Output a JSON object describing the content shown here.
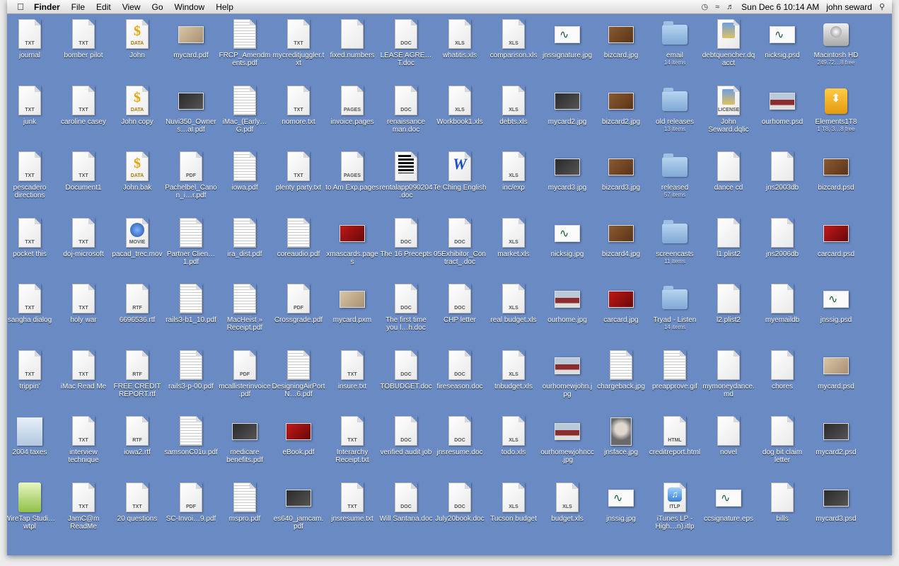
{
  "menubar": {
    "apple": "",
    "app": "Finder",
    "menus": [
      "File",
      "Edit",
      "View",
      "Go",
      "Window",
      "Help"
    ],
    "clock": "Sun Dec 6  10:14 AM",
    "user": "john seward",
    "status_icons": [
      "wifi-icon",
      "volume-icon",
      "time-machine-icon",
      "search-icon"
    ]
  },
  "desktop": {
    "columns": [
      [
        {
          "label": "journal",
          "kind": "txt",
          "tag": "TXT"
        },
        {
          "label": "junk",
          "kind": "txt",
          "tag": "TXT"
        },
        {
          "label": "pescadero directions",
          "kind": "txt",
          "tag": "TXT"
        },
        {
          "label": "pocket this",
          "kind": "txt",
          "tag": "TXT"
        },
        {
          "label": "sangha dialog",
          "kind": "txt",
          "tag": "TXT"
        },
        {
          "label": "trippin'",
          "kind": "txt",
          "tag": "TXT"
        },
        {
          "label": "2004 taxes",
          "kind": "taxes"
        },
        {
          "label": "WireTap Studi…wtpl",
          "kind": "wiretap"
        }
      ],
      [
        {
          "label": "bomber pilot",
          "kind": "txt",
          "tag": "TXT"
        },
        {
          "label": "caroline casey",
          "kind": "txt",
          "tag": "TXT"
        },
        {
          "label": "Document1",
          "kind": "txt",
          "tag": "TXT"
        },
        {
          "label": "doj-microsoft",
          "kind": "txt",
          "tag": "TXT"
        },
        {
          "label": "holy war",
          "kind": "txt",
          "tag": "TXT"
        },
        {
          "label": "iMac Read Me",
          "kind": "txt",
          "tag": "TXT"
        },
        {
          "label": "interview technique",
          "kind": "txt",
          "tag": "TXT"
        },
        {
          "label": "JamC@m ReadMe",
          "kind": "txt",
          "tag": "TXT"
        }
      ],
      [
        {
          "label": "John",
          "kind": "data",
          "tag": "DATA"
        },
        {
          "label": "John copy",
          "kind": "data",
          "tag": "DATA"
        },
        {
          "label": "John.bak",
          "kind": "data",
          "tag": "DATA"
        },
        {
          "label": "pacad_trec.mov",
          "kind": "movie",
          "tag": "MOVIE"
        },
        {
          "label": "6696536.rtf",
          "kind": "txt",
          "tag": "RTF"
        },
        {
          "label": "FREE CREDIT REPORT.rtf",
          "kind": "txt",
          "tag": "RTF"
        },
        {
          "label": "iowa2.rtf",
          "kind": "txt",
          "tag": "RTF"
        },
        {
          "label": "20 questions",
          "kind": "txt",
          "tag": "TXT"
        }
      ],
      [
        {
          "label": "mycard.pdf",
          "kind": "photo-tan"
        },
        {
          "label": "Nuvi350_Owners…al.pdf",
          "kind": "photo-dark"
        },
        {
          "label": "Pachelbel_Canon_i…r.pdf",
          "kind": "txt",
          "tag": "PDF"
        },
        {
          "label": "Partner Clien…1.pdf",
          "kind": "lines"
        },
        {
          "label": "rails3-b1_10.pdf",
          "kind": "lines"
        },
        {
          "label": "rails3-p-00.pdf",
          "kind": "lines"
        },
        {
          "label": "samsonC01u.pdf",
          "kind": "lines"
        },
        {
          "label": "SC-Invoi…9.pdf",
          "kind": "txt",
          "tag": "PDF"
        }
      ],
      [
        {
          "label": "FRCP_Amendments.pdf",
          "kind": "lines"
        },
        {
          "label": "iMac_(Early…G.pdf",
          "kind": "lines"
        },
        {
          "label": "iowa.pdf",
          "kind": "lines"
        },
        {
          "label": "ira_dist.pdf",
          "kind": "lines"
        },
        {
          "label": "MacHeist » Receipt.pdf",
          "kind": "lines"
        },
        {
          "label": "mcallisterinvoice.pdf",
          "kind": "txt",
          "tag": "PDF"
        },
        {
          "label": "medicare benefits.pdf",
          "kind": "photo-dark"
        },
        {
          "label": "mspro.pdf",
          "kind": "lines"
        }
      ],
      [
        {
          "label": "mycreditjuggler.txt",
          "kind": "txt",
          "tag": "TXT"
        },
        {
          "label": "nomore.txt",
          "kind": "txt",
          "tag": "TXT"
        },
        {
          "label": "plenty party.txt",
          "kind": "txt",
          "tag": "TXT"
        },
        {
          "label": "coreaudio.pdf",
          "kind": "lines"
        },
        {
          "label": "Crossgrade.pdf",
          "kind": "txt",
          "tag": "PDF"
        },
        {
          "label": "DesigningAirPortN…6.pdf",
          "kind": "lines"
        },
        {
          "label": "eBook.pdf",
          "kind": "photo-red"
        },
        {
          "label": "es640_jamcam.pdf",
          "kind": "photo-dark"
        }
      ],
      [
        {
          "label": "fixed.numbers",
          "kind": "txt",
          "tag": ""
        },
        {
          "label": "invoice.pages",
          "kind": "txt",
          "tag": "PAGES"
        },
        {
          "label": "to Am Exp.pages",
          "kind": "txt",
          "tag": "PAGES"
        },
        {
          "label": "xmascards.pages",
          "kind": "photo-red"
        },
        {
          "label": "mycard.pxm",
          "kind": "photo-tan"
        },
        {
          "label": "insure.txt",
          "kind": "txt",
          "tag": "TXT"
        },
        {
          "label": "Interarchy Receipt.txt",
          "kind": "txt",
          "tag": "TXT"
        },
        {
          "label": "jnsresume.txt",
          "kind": "txt",
          "tag": "TXT"
        }
      ],
      [
        {
          "label": "LEASE AGRE…T.doc",
          "kind": "txt",
          "tag": "DOC"
        },
        {
          "label": "renaissance man.doc",
          "kind": "txt",
          "tag": "DOC"
        },
        {
          "label": "rentalapp090204.doc",
          "kind": "black"
        },
        {
          "label": "The 16 Precepts",
          "kind": "txt",
          "tag": "DOC"
        },
        {
          "label": "The first time you l…h.doc",
          "kind": "txt",
          "tag": "DOC"
        },
        {
          "label": "TOBUDGET.doc",
          "kind": "txt",
          "tag": "DOC"
        },
        {
          "label": "verified audit job",
          "kind": "txt",
          "tag": "DOC"
        },
        {
          "label": "Will Santana.doc",
          "kind": "txt",
          "tag": "DOC"
        }
      ],
      [
        {
          "label": "whatitis.xls",
          "kind": "txt",
          "tag": "XLS"
        },
        {
          "label": "Workbook1.xls",
          "kind": "txt",
          "tag": "XLS"
        },
        {
          "label": "Te Ching English",
          "kind": "te"
        },
        {
          "label": "05Exhibitor_Contract_.doc",
          "kind": "txt",
          "tag": "DOC"
        },
        {
          "label": "CHP letter",
          "kind": "txt",
          "tag": "DOC"
        },
        {
          "label": "fireseason.doc",
          "kind": "txt",
          "tag": "DOC"
        },
        {
          "label": "jnsresume.doc",
          "kind": "txt",
          "tag": "DOC"
        },
        {
          "label": "July20book.doc",
          "kind": "txt",
          "tag": "DOC"
        }
      ],
      [
        {
          "label": "comparison.xls",
          "kind": "txt",
          "tag": "XLS"
        },
        {
          "label": "debts.xls",
          "kind": "txt",
          "tag": "XLS"
        },
        {
          "label": "inc/exp",
          "kind": "txt",
          "tag": "XLS"
        },
        {
          "label": "market.xls",
          "kind": "txt",
          "tag": "XLS"
        },
        {
          "label": "real budget.xls",
          "kind": "txt",
          "tag": "XLS"
        },
        {
          "label": "tnbudget.xls",
          "kind": "txt",
          "tag": "XLS"
        },
        {
          "label": "todo.xls",
          "kind": "txt",
          "tag": "XLS"
        },
        {
          "label": "Tucson budget",
          "kind": "txt",
          "tag": "XLS"
        }
      ],
      [
        {
          "label": "jnssignature.jpg",
          "kind": "photo-sig"
        },
        {
          "label": "mycard2.jpg",
          "kind": "photo-dark"
        },
        {
          "label": "mycard3.jpg",
          "kind": "photo-dark"
        },
        {
          "label": "nicksig.jpg",
          "kind": "photo-sig"
        },
        {
          "label": "ourhome.jpg",
          "kind": "photo-house"
        },
        {
          "label": "ourhomewjohn.jpg",
          "kind": "photo-house"
        },
        {
          "label": "ourhomewjohncc.jpg",
          "kind": "photo-house"
        },
        {
          "label": "budget.xls",
          "kind": "txt",
          "tag": "XLS"
        }
      ],
      [
        {
          "label": "bizcard.jpg",
          "kind": "photo-brown"
        },
        {
          "label": "bizcard2.jpg",
          "kind": "photo-brown"
        },
        {
          "label": "bizcard3.jpg",
          "kind": "photo-brown"
        },
        {
          "label": "bizcard4.jpg",
          "kind": "photo-brown"
        },
        {
          "label": "carcard.jpg",
          "kind": "photo-red"
        },
        {
          "label": "chargeback.jpg",
          "kind": "lines"
        },
        {
          "label": "jnsface.jpg",
          "kind": "photo-portrait"
        },
        {
          "label": "jnssig.jpg",
          "kind": "photo-sig"
        }
      ],
      [
        {
          "label": "email",
          "sub": "14 items",
          "kind": "folder"
        },
        {
          "label": "old releases",
          "sub": "13 items",
          "kind": "folder"
        },
        {
          "label": "released",
          "sub": "57 items",
          "kind": "folder"
        },
        {
          "label": "screencasts",
          "sub": "11 items",
          "kind": "folder"
        },
        {
          "label": "Tryad - Listen",
          "sub": "14 items",
          "kind": "folder"
        },
        {
          "label": "preapprove.gif",
          "kind": "lines"
        },
        {
          "label": "creditreport.html",
          "kind": "txt",
          "tag": "HTML"
        },
        {
          "label": "iTunes LP - High…n).itlp",
          "kind": "itlp",
          "tag": "ITLP"
        }
      ],
      [
        {
          "label": "debtquencher.dqacct",
          "kind": "license"
        },
        {
          "label": "John Seward.dqlic",
          "kind": "license",
          "tag": "LICENSE"
        },
        {
          "label": "dance cd",
          "kind": "txt",
          "tag": ""
        },
        {
          "label": "l1.plist2",
          "kind": "txt",
          "tag": ""
        },
        {
          "label": "l2.plist2",
          "kind": "txt",
          "tag": ""
        },
        {
          "label": "mymoneydance.md",
          "kind": "txt",
          "tag": ""
        },
        {
          "label": "novel",
          "kind": "txt",
          "tag": ""
        },
        {
          "label": "ccsignature.eps",
          "kind": "photo-sig"
        }
      ],
      [
        {
          "label": "nicksig.psd",
          "kind": "photo-sig"
        },
        {
          "label": "ourhome.psd",
          "kind": "photo-house"
        },
        {
          "label": "jns2003db",
          "kind": "txt",
          "tag": ""
        },
        {
          "label": "jns2006db",
          "kind": "txt",
          "tag": ""
        },
        {
          "label": "myemaildb",
          "kind": "txt",
          "tag": ""
        },
        {
          "label": "chores",
          "kind": "txt",
          "tag": ""
        },
        {
          "label": "dog bit claim letter",
          "kind": "txt",
          "tag": ""
        },
        {
          "label": "bills",
          "kind": "txt",
          "tag": ""
        }
      ],
      [
        {
          "label": "Macintosh HD",
          "sub": "249.72…8 free",
          "kind": "drive"
        },
        {
          "label": "Elements1T8",
          "sub": "1 T8, 3…8 free",
          "kind": "usb"
        },
        {
          "label": "bizcard.psd",
          "kind": "photo-brown"
        },
        {
          "label": "carcard.psd",
          "kind": "photo-red"
        },
        {
          "label": "jnssig.psd",
          "kind": "photo-sig"
        },
        {
          "label": "mycard.psd",
          "kind": "photo-tan"
        },
        {
          "label": "mycard2.psd",
          "kind": "photo-dark"
        },
        {
          "label": "mycard3.psd",
          "kind": "photo-dark"
        }
      ]
    ]
  }
}
